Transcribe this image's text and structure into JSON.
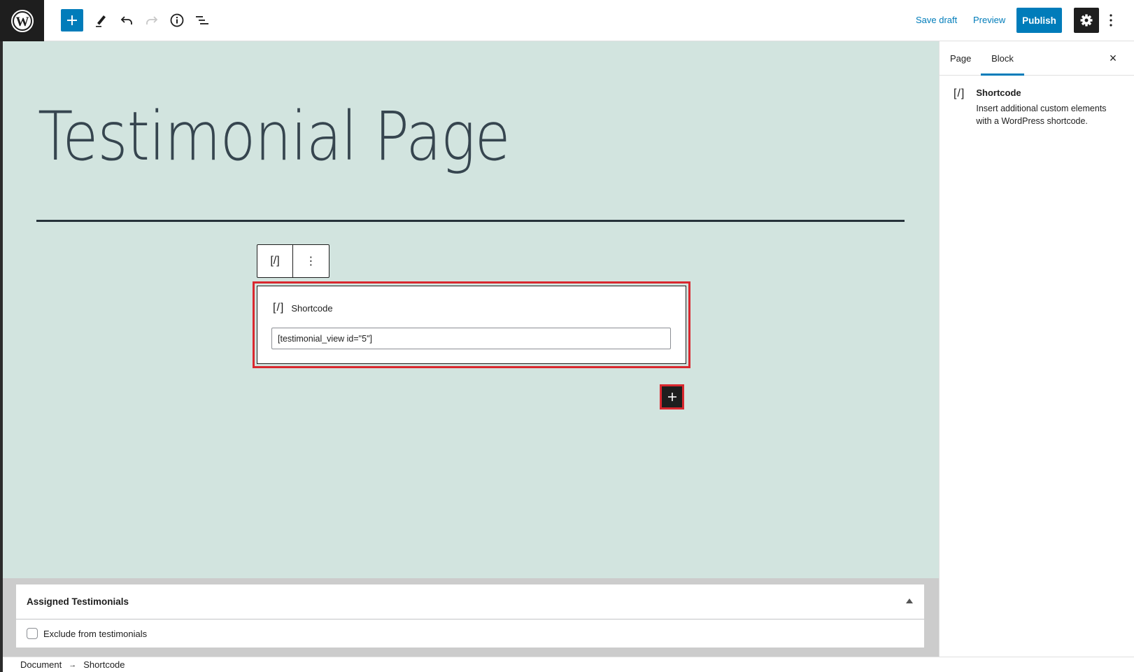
{
  "toolbar": {
    "logo_icon": "wordpress-icon",
    "add_block_icon": "plus-icon",
    "tools_icon": "pencil-icon",
    "undo_icon": "undo-icon",
    "redo_icon": "redo-icon",
    "details_icon": "info-icon",
    "list_view_icon": "list-view-icon",
    "save_draft_label": "Save draft",
    "preview_label": "Preview",
    "publish_label": "Publish",
    "settings_icon": "gear-icon",
    "options_icon": "more-vertical-icon"
  },
  "editor": {
    "page_title": "Testimonial Page",
    "block_toolbar": {
      "block_type_icon": "[/]",
      "options_icon": "⋮"
    },
    "shortcode_block": {
      "icon": "[/]",
      "label": "Shortcode",
      "value": "[testimonial_view id=\"5\"]"
    },
    "inserter_icon": "plus-icon"
  },
  "metabox": {
    "title": "Assigned Testimonials",
    "checkbox_label": "Exclude from testimonials",
    "checkbox_checked": false
  },
  "breadcrumb": {
    "items": [
      "Document",
      "Shortcode"
    ],
    "separator": "→"
  },
  "sidebar": {
    "tabs": [
      {
        "label": "Page",
        "active": false
      },
      {
        "label": "Block",
        "active": true
      }
    ],
    "close_icon": "×",
    "block_card": {
      "icon": "[/]",
      "title": "Shortcode",
      "description": "Insert additional custom elements with a WordPress shortcode."
    }
  },
  "colors": {
    "accent": "#007cba",
    "canvas_bg": "#d2e4df",
    "highlight": "#d9282f",
    "dark": "#1e1e1e"
  }
}
